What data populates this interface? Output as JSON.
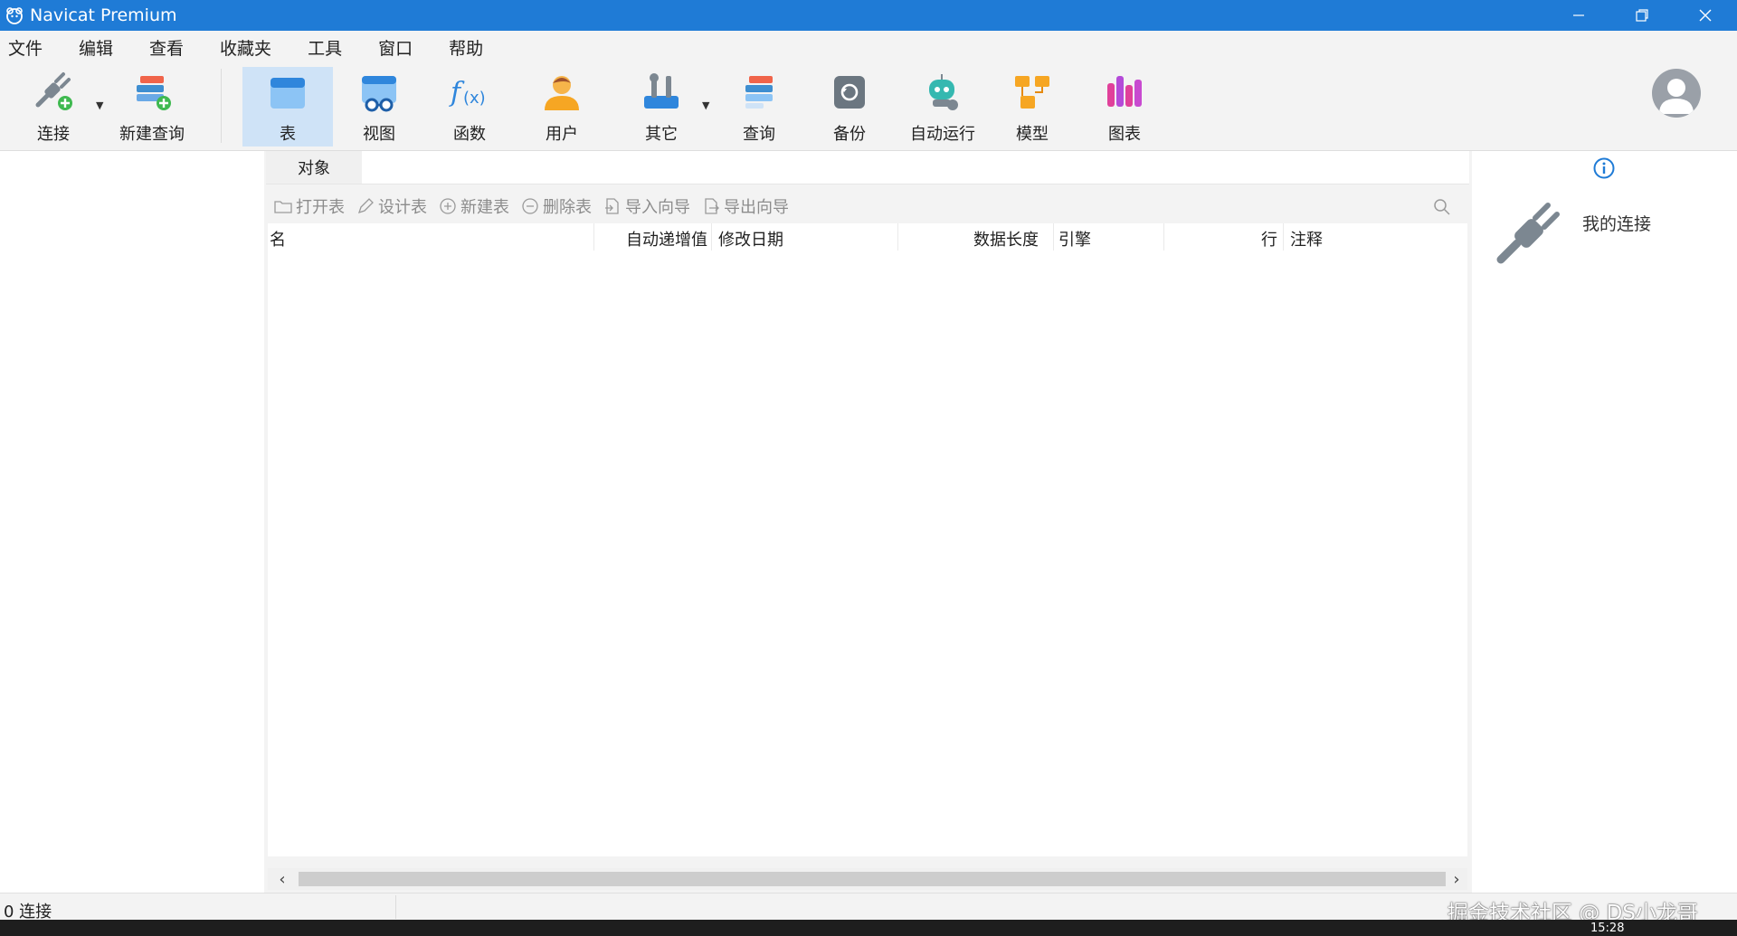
{
  "window": {
    "title": "Navicat Premium"
  },
  "menu": [
    "文件",
    "编辑",
    "查看",
    "收藏夹",
    "工具",
    "窗口",
    "帮助"
  ],
  "toolbar": {
    "connect": "连接",
    "new_query": "新建查询",
    "table": "表",
    "view": "视图",
    "function": "函数",
    "user": "用户",
    "other": "其它",
    "query": "查询",
    "backup": "备份",
    "automation": "自动运行",
    "model": "模型",
    "chart": "图表"
  },
  "tabs": {
    "objects": "对象"
  },
  "object_toolbar": {
    "open_table": "打开表",
    "design_table": "设计表",
    "new_table": "新建表",
    "delete_table": "删除表",
    "import_wizard": "导入向导",
    "export_wizard": "导出向导"
  },
  "table_columns": {
    "name": "名",
    "auto_increment": "自动递增值",
    "modified_date": "修改日期",
    "data_length": "数据长度",
    "engine": "引擎",
    "rows": "行",
    "comment": "注释"
  },
  "right_panel": {
    "connection_label": "我的连接"
  },
  "status": {
    "connections": "0 连接",
    "watermark": "掘金技术社区 @ DS小龙哥"
  },
  "taskbar": {
    "clock": "15:28"
  },
  "colors": {
    "titlebar": "#1f7bd6",
    "active_tool": "#cfe3f7",
    "accent": "#1f7bd6"
  }
}
